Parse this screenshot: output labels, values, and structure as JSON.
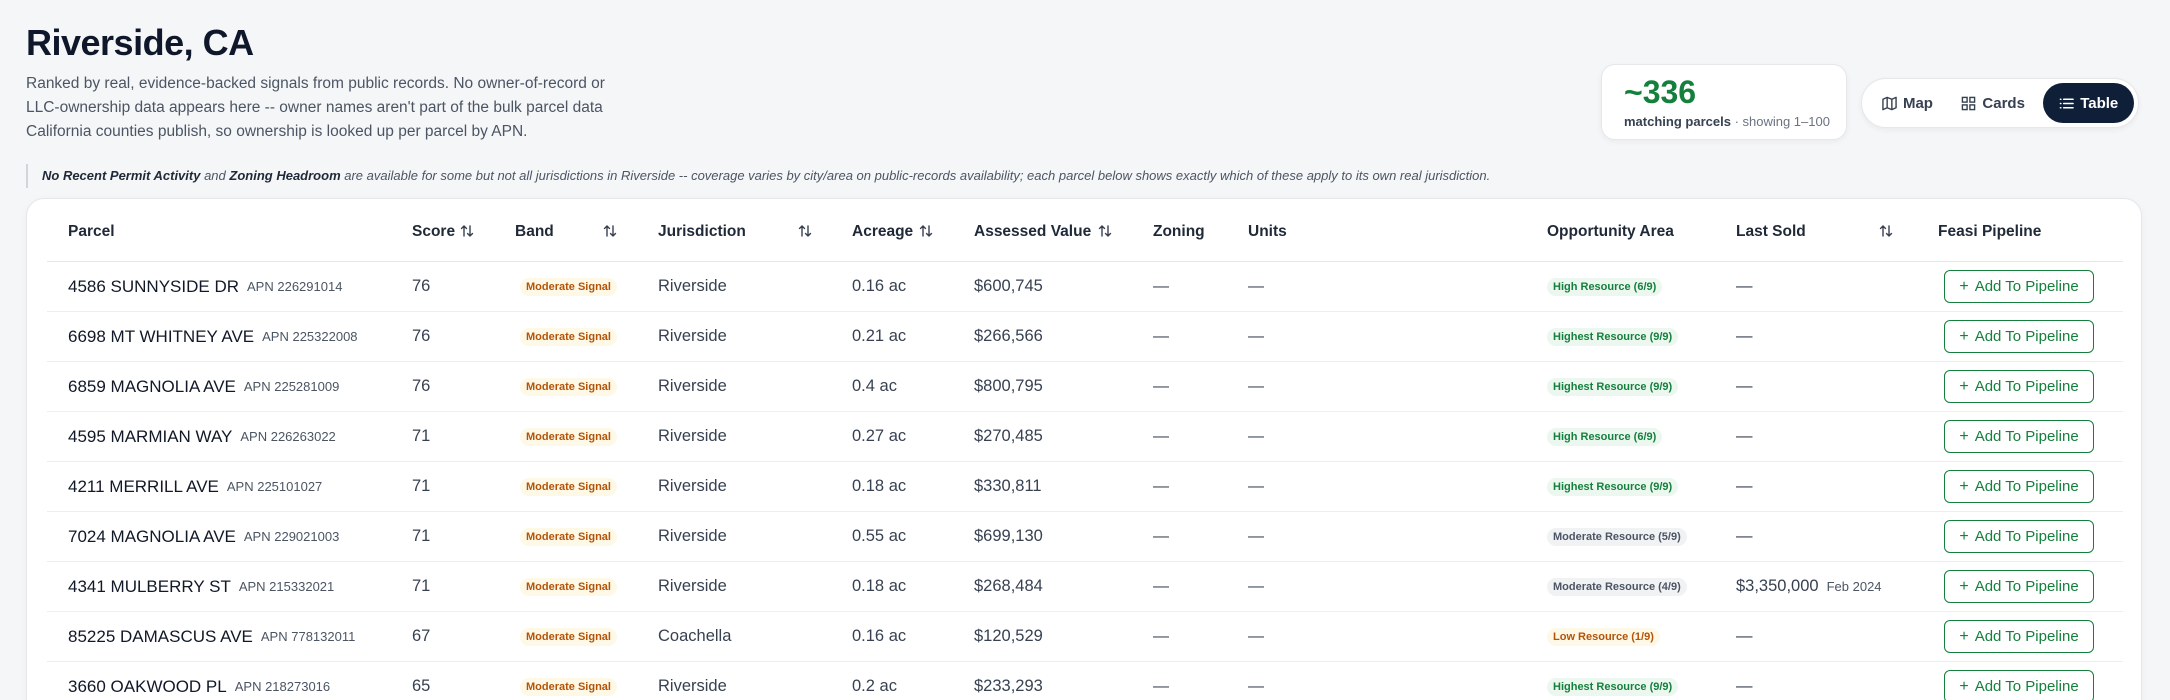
{
  "header": {
    "title": "Riverside, CA",
    "description": "Ranked by real, evidence-backed signals from public records. No owner-of-record or LLC-ownership data appears here -- owner names aren't part of the bulk parcel data California counties publish, so ownership is looked up per parcel by APN."
  },
  "count_card": {
    "count": "~336",
    "label": "matching parcels",
    "showing": "· showing 1–100"
  },
  "view_toggle": {
    "map": "Map",
    "cards": "Cards",
    "table": "Table",
    "active": "table"
  },
  "note": {
    "term1": "No Recent Permit Activity",
    "join": "and",
    "term2": "Zoning Headroom",
    "rest": "are available for some but not all jurisdictions in Riverside -- coverage varies by city/area on public-records availability; each parcel below shows exactly which of these apply to its own real jurisdiction."
  },
  "table": {
    "columns": {
      "parcel": "Parcel",
      "score": "Score",
      "band": "Band",
      "jurisdiction": "Jurisdiction",
      "acreage": "Acreage",
      "assessed": "Assessed Value",
      "zoning": "Zoning",
      "units": "Units",
      "opportunity": "Opportunity Area",
      "last_sold": "Last Sold",
      "pipeline": "Feasi Pipeline"
    },
    "add_label": "Add To Pipeline",
    "rows": [
      {
        "address": "4586 SUNNYSIDE DR",
        "apn": "APN 226291014",
        "score": "76",
        "band": "Moderate Signal",
        "jurisdiction": "Riverside",
        "acreage": "0.16 ac",
        "assessed": "$600,745",
        "zoning": "—",
        "units": "—",
        "opportunity": "High Resource (6/9)",
        "opp_level": "high",
        "last_sold": "—",
        "sold_date": ""
      },
      {
        "address": "6698 MT WHITNEY AVE",
        "apn": "APN 225322008",
        "score": "76",
        "band": "Moderate Signal",
        "jurisdiction": "Riverside",
        "acreage": "0.21 ac",
        "assessed": "$266,566",
        "zoning": "—",
        "units": "—",
        "opportunity": "Highest Resource (9/9)",
        "opp_level": "high",
        "last_sold": "—",
        "sold_date": ""
      },
      {
        "address": "6859 MAGNOLIA AVE",
        "apn": "APN 225281009",
        "score": "76",
        "band": "Moderate Signal",
        "jurisdiction": "Riverside",
        "acreage": "0.4 ac",
        "assessed": "$800,795",
        "zoning": "—",
        "units": "—",
        "opportunity": "Highest Resource (9/9)",
        "opp_level": "high",
        "last_sold": "—",
        "sold_date": ""
      },
      {
        "address": "4595 MARMIAN WAY",
        "apn": "APN 226263022",
        "score": "71",
        "band": "Moderate Signal",
        "jurisdiction": "Riverside",
        "acreage": "0.27 ac",
        "assessed": "$270,485",
        "zoning": "—",
        "units": "—",
        "opportunity": "High Resource (6/9)",
        "opp_level": "high",
        "last_sold": "—",
        "sold_date": ""
      },
      {
        "address": "4211 MERRILL AVE",
        "apn": "APN 225101027",
        "score": "71",
        "band": "Moderate Signal",
        "jurisdiction": "Riverside",
        "acreage": "0.18 ac",
        "assessed": "$330,811",
        "zoning": "—",
        "units": "—",
        "opportunity": "Highest Resource (9/9)",
        "opp_level": "high",
        "last_sold": "—",
        "sold_date": ""
      },
      {
        "address": "7024 MAGNOLIA AVE",
        "apn": "APN 229021003",
        "score": "71",
        "band": "Moderate Signal",
        "jurisdiction": "Riverside",
        "acreage": "0.55 ac",
        "assessed": "$699,130",
        "zoning": "—",
        "units": "—",
        "opportunity": "Moderate Resource (5/9)",
        "opp_level": "mod",
        "last_sold": "—",
        "sold_date": ""
      },
      {
        "address": "4341 MULBERRY ST",
        "apn": "APN 215332021",
        "score": "71",
        "band": "Moderate Signal",
        "jurisdiction": "Riverside",
        "acreage": "0.18 ac",
        "assessed": "$268,484",
        "zoning": "—",
        "units": "—",
        "opportunity": "Moderate Resource (4/9)",
        "opp_level": "mod",
        "last_sold": "$3,350,000",
        "sold_date": "Feb 2024"
      },
      {
        "address": "85225 DAMASCUS AVE",
        "apn": "APN 778132011",
        "score": "67",
        "band": "Moderate Signal",
        "jurisdiction": "Coachella",
        "acreage": "0.16 ac",
        "assessed": "$120,529",
        "zoning": "—",
        "units": "—",
        "opportunity": "Low Resource (1/9)",
        "opp_level": "low",
        "last_sold": "—",
        "sold_date": ""
      },
      {
        "address": "3660 OAKWOOD PL",
        "apn": "APN 218273016",
        "score": "65",
        "band": "Moderate Signal",
        "jurisdiction": "Riverside",
        "acreage": "0.2 ac",
        "assessed": "$233,293",
        "zoning": "—",
        "units": "—",
        "opportunity": "Highest Resource (9/9)",
        "opp_level": "high",
        "last_sold": "—",
        "sold_date": ""
      }
    ]
  },
  "colors": {
    "accent_green": "#15803d",
    "navy": "#0f1f38",
    "band_amber": "#b45309"
  }
}
